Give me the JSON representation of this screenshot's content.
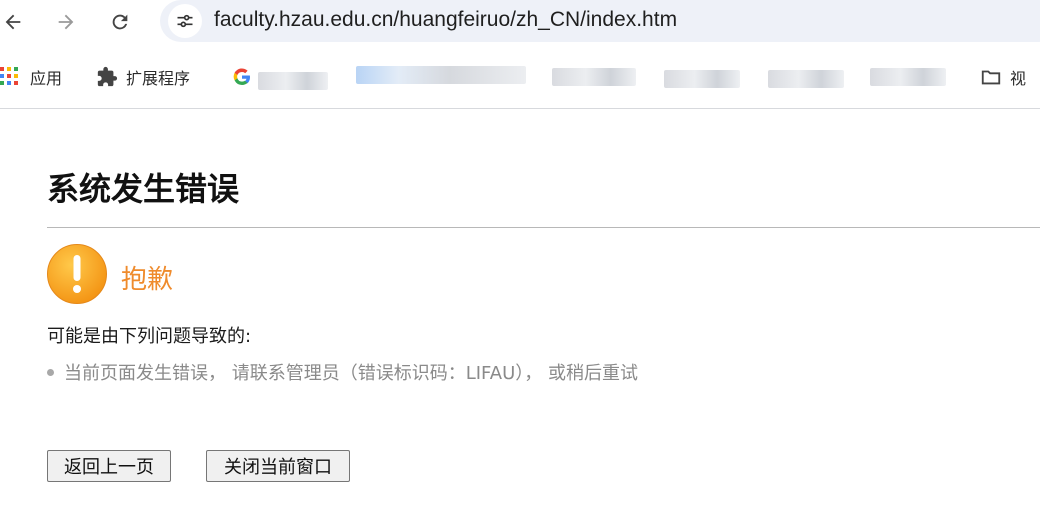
{
  "browser": {
    "url": "faculty.hzau.edu.cn/huangfeiruo/zh_CN/index.htm",
    "bookmarks": {
      "apps_label": "应用",
      "extensions_label": "扩展程序",
      "folder_label": "视"
    }
  },
  "page": {
    "title": "系统发生错误",
    "sorry": "抱歉",
    "cause_heading": "可能是由下列问题导致的:",
    "detail": "当前页面发生错误， 请联系管理员（错误标识码：LIFAU）， 或稍后重试",
    "buttons": {
      "back": "返回上一页",
      "close": "关闭当前窗口"
    }
  },
  "colors": {
    "accent": "#ef8b2c",
    "warning_icon": "#f7a21b",
    "muted_text": "#8a8a8a"
  }
}
